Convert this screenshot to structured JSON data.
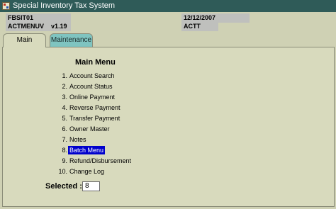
{
  "window": {
    "title": "Special Inventory Tax System"
  },
  "header": {
    "screen_id": "FBSIT01",
    "menu_id": "ACTMENUV",
    "version": "v1.19",
    "date": "12/12/2007",
    "user": "ACTT"
  },
  "tabs": [
    {
      "label": "Main",
      "active": true
    },
    {
      "label": "Maintenance",
      "active": false
    }
  ],
  "main": {
    "title": "Main Menu",
    "items": [
      {
        "num": "1.",
        "label": "Account Search"
      },
      {
        "num": "2.",
        "label": "Account Status"
      },
      {
        "num": "3.",
        "label": "Online Payment"
      },
      {
        "num": "4.",
        "label": "Reverse Payment"
      },
      {
        "num": "5.",
        "label": "Transfer Payment"
      },
      {
        "num": "6.",
        "label": "Owner Master"
      },
      {
        "num": "7.",
        "label": "Notes"
      },
      {
        "num": "8.",
        "label": "Batch Menu",
        "selected": true
      },
      {
        "num": "9.",
        "label": "Refund/Disbursement"
      },
      {
        "num": "10.",
        "label": "Change Log"
      }
    ],
    "selected_label": "Selected :",
    "selected_value": "8"
  },
  "colors": {
    "titlebar": "#2f5b58",
    "background": "#cfd1b4",
    "maintenance_tab": "#7fc4c0",
    "selection": "#0000cc"
  }
}
